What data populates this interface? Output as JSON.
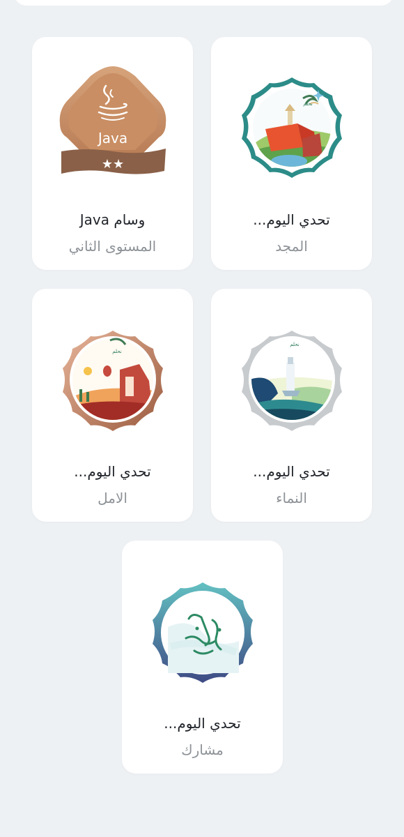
{
  "badges": [
    {
      "title": "تحدي اليوم...",
      "subtitle": "المجد",
      "icon": "challenge-badge-almajd-icon"
    },
    {
      "title": "وسام Java",
      "subtitle": "المستوى الثاني",
      "icon": "java-badge-icon"
    },
    {
      "title": "تحدي اليوم...",
      "subtitle": "النماء",
      "icon": "challenge-badge-alnamaa-icon"
    },
    {
      "title": "تحدي اليوم...",
      "subtitle": "الامل",
      "icon": "challenge-badge-alamal-icon"
    },
    {
      "title": "تحدي اليوم...",
      "subtitle": "مشارك",
      "icon": "challenge-badge-participant-icon"
    }
  ],
  "java_badge": {
    "label": "Java",
    "stars": "★★"
  },
  "colors": {
    "background": "#eef1f4",
    "card": "#ffffff",
    "title": "#1f2329",
    "subtitle": "#8d9297",
    "java_copper": "#c98e63",
    "java_ribbon": "#8a6048"
  }
}
